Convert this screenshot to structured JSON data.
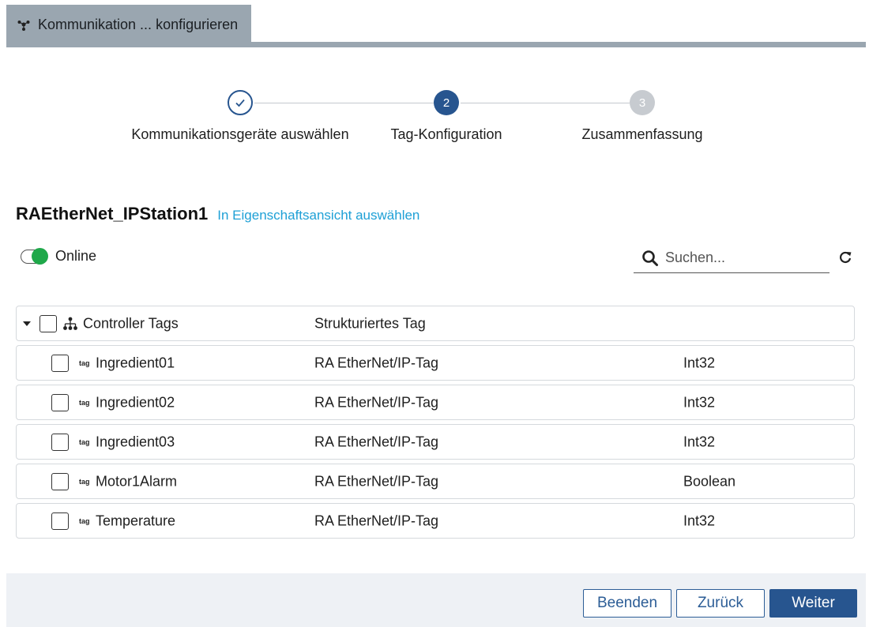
{
  "header": {
    "tab_title": "Kommunikation ... konfigurieren",
    "tab_icon": "network-icon"
  },
  "stepper": {
    "steps": [
      {
        "label": "Kommunikationsgeräte auswählen",
        "state": "done"
      },
      {
        "label": "Tag-Konfiguration",
        "number": "2",
        "state": "active"
      },
      {
        "label": "Zusammenfassung",
        "number": "3",
        "state": "todo"
      }
    ]
  },
  "station": {
    "name": "RAEtherNet_IPStation1",
    "link": "In Eigenschaftsansicht auswählen"
  },
  "online": {
    "label": "Online",
    "enabled": true
  },
  "search": {
    "placeholder": "Suchen...",
    "value": ""
  },
  "tree": {
    "parent": {
      "name": "Controller Tags",
      "type": "Strukturiertes Tag",
      "expanded": true
    },
    "items": [
      {
        "name": "Ingredient01",
        "type": "RA EtherNet/IP-Tag",
        "datatype": "Int32"
      },
      {
        "name": "Ingredient02",
        "type": "RA EtherNet/IP-Tag",
        "datatype": "Int32"
      },
      {
        "name": "Ingredient03",
        "type": "RA EtherNet/IP-Tag",
        "datatype": "Int32"
      },
      {
        "name": "Motor1Alarm",
        "type": "RA EtherNet/IP-Tag",
        "datatype": "Boolean"
      },
      {
        "name": "Temperature",
        "type": "RA EtherNet/IP-Tag",
        "datatype": "Int32"
      }
    ],
    "tag_icon_label": "tag"
  },
  "footer": {
    "finish": "Beenden",
    "back": "Zurück",
    "next": "Weiter"
  },
  "colors": {
    "primary": "#27558f",
    "link": "#1ea0d6",
    "online": "#1fa84a",
    "tab": "#9aa6b0"
  }
}
